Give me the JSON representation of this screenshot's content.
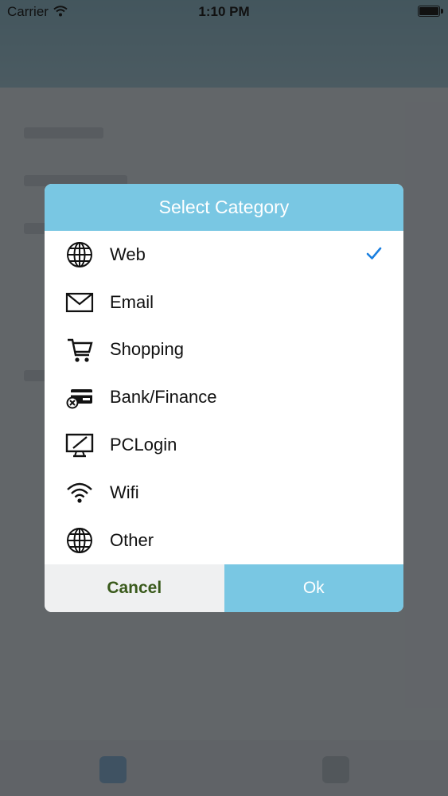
{
  "status_bar": {
    "carrier": "Carrier",
    "time": "1:10 PM",
    "battery_level": 1.0
  },
  "dialog": {
    "title": "Select Category",
    "selected_index": 0,
    "categories": [
      {
        "label": "Web",
        "icon": "globe-icon"
      },
      {
        "label": "Email",
        "icon": "envelope-icon"
      },
      {
        "label": "Shopping",
        "icon": "cart-icon"
      },
      {
        "label": "Bank/Finance",
        "icon": "card-icon"
      },
      {
        "label": "PCLogin",
        "icon": "monitor-icon"
      },
      {
        "label": "Wifi",
        "icon": "wifi-icon"
      },
      {
        "label": "Other",
        "icon": "globe-icon"
      }
    ],
    "cancel_label": "Cancel",
    "ok_label": "Ok"
  },
  "colors": {
    "accent": "#79c7e3",
    "check": "#1a7fe0",
    "cancel_text": "#3a5a1c",
    "overlay": "#2d3034"
  }
}
